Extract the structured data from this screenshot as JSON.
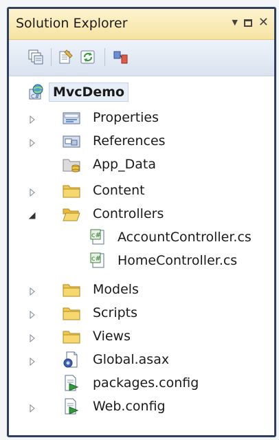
{
  "panel": {
    "title": "Solution Explorer",
    "controls": [
      "dropdown-arrow-icon",
      "maximize-icon",
      "close-icon"
    ]
  },
  "toolbar": {
    "buttons": [
      "show-all-files-icon",
      "properties-icon",
      "refresh-icon",
      "view-class-diagram-icon"
    ]
  },
  "tree": {
    "root": {
      "label": "MvcDemo",
      "icon": "web-project-icon"
    },
    "items": [
      {
        "label": "Properties",
        "icon": "properties-folder-icon",
        "expander": "collapsed"
      },
      {
        "label": "References",
        "icon": "references-folder-icon",
        "expander": "collapsed"
      },
      {
        "label": "App_Data",
        "icon": "app-data-folder-icon",
        "expander": "none"
      },
      {
        "label": "Content",
        "icon": "folder-icon",
        "expander": "collapsed"
      },
      {
        "label": "Controllers",
        "icon": "open-folder-icon",
        "expander": "expanded"
      },
      {
        "label": "AccountController.cs",
        "icon": "csharp-file-icon",
        "expander": "none"
      },
      {
        "label": "HomeController.cs",
        "icon": "csharp-file-icon",
        "expander": "none"
      },
      {
        "label": "Models",
        "icon": "folder-icon",
        "expander": "collapsed"
      },
      {
        "label": "Scripts",
        "icon": "folder-icon",
        "expander": "collapsed"
      },
      {
        "label": "Views",
        "icon": "folder-icon",
        "expander": "collapsed"
      },
      {
        "label": "Global.asax",
        "icon": "asax-file-icon",
        "expander": "collapsed"
      },
      {
        "label": "packages.config",
        "icon": "config-file-icon",
        "expander": "none"
      },
      {
        "label": "Web.config",
        "icon": "config-file-icon",
        "expander": "collapsed"
      }
    ]
  },
  "colors": {
    "titlebar": "#f6e3a3",
    "frame_border": "#2e3f5f",
    "folder": "#f2c94c",
    "toolbar": "#dde6f2"
  }
}
